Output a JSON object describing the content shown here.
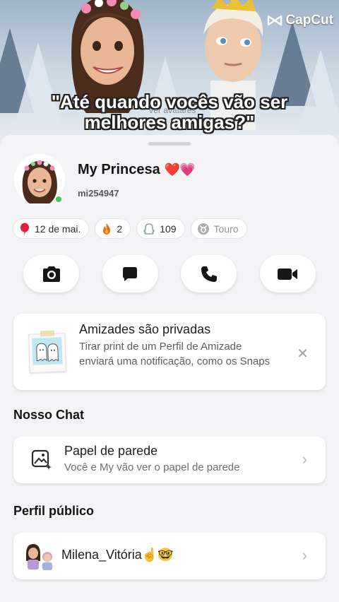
{
  "video": {
    "watermark": "CapCut",
    "caption_line1": "\"Até quando vocês vão ser",
    "caption_line2": "melhores amigas?\"",
    "faded_text": "Ver avatares"
  },
  "profile": {
    "name": "My Princesa",
    "name_emoji": "❤️💗",
    "username": "mi254947",
    "online": true
  },
  "chips": [
    {
      "icon": "balloon-icon",
      "label": "12 de mai."
    },
    {
      "icon": "fire-icon",
      "label": "2"
    },
    {
      "icon": "snap-score-icon",
      "label": "109"
    },
    {
      "icon": "zodiac-icon",
      "label": "Touro"
    }
  ],
  "actions": [
    {
      "icon": "camera-icon"
    },
    {
      "icon": "chat-icon"
    },
    {
      "icon": "phone-icon"
    },
    {
      "icon": "video-icon"
    }
  ],
  "privacy_card": {
    "title": "Amizades são privadas",
    "body": "Tirar print de um Perfil de Amizade enviará uma notificação, como os Snaps"
  },
  "our_chat": {
    "heading": "Nosso Chat",
    "wallpaper_title": "Papel de parede",
    "wallpaper_sub": "Você e My vão ver o papel de parede"
  },
  "public_profile": {
    "heading": "Perfil público",
    "name": "Milena_Vitória",
    "emoji": "☝️🤓"
  },
  "colors": {
    "online": "#3cc55b",
    "sheet_bg": "#f4f4f7",
    "heart_red": "#e0202f",
    "heart_pink": "#f25a9e"
  }
}
